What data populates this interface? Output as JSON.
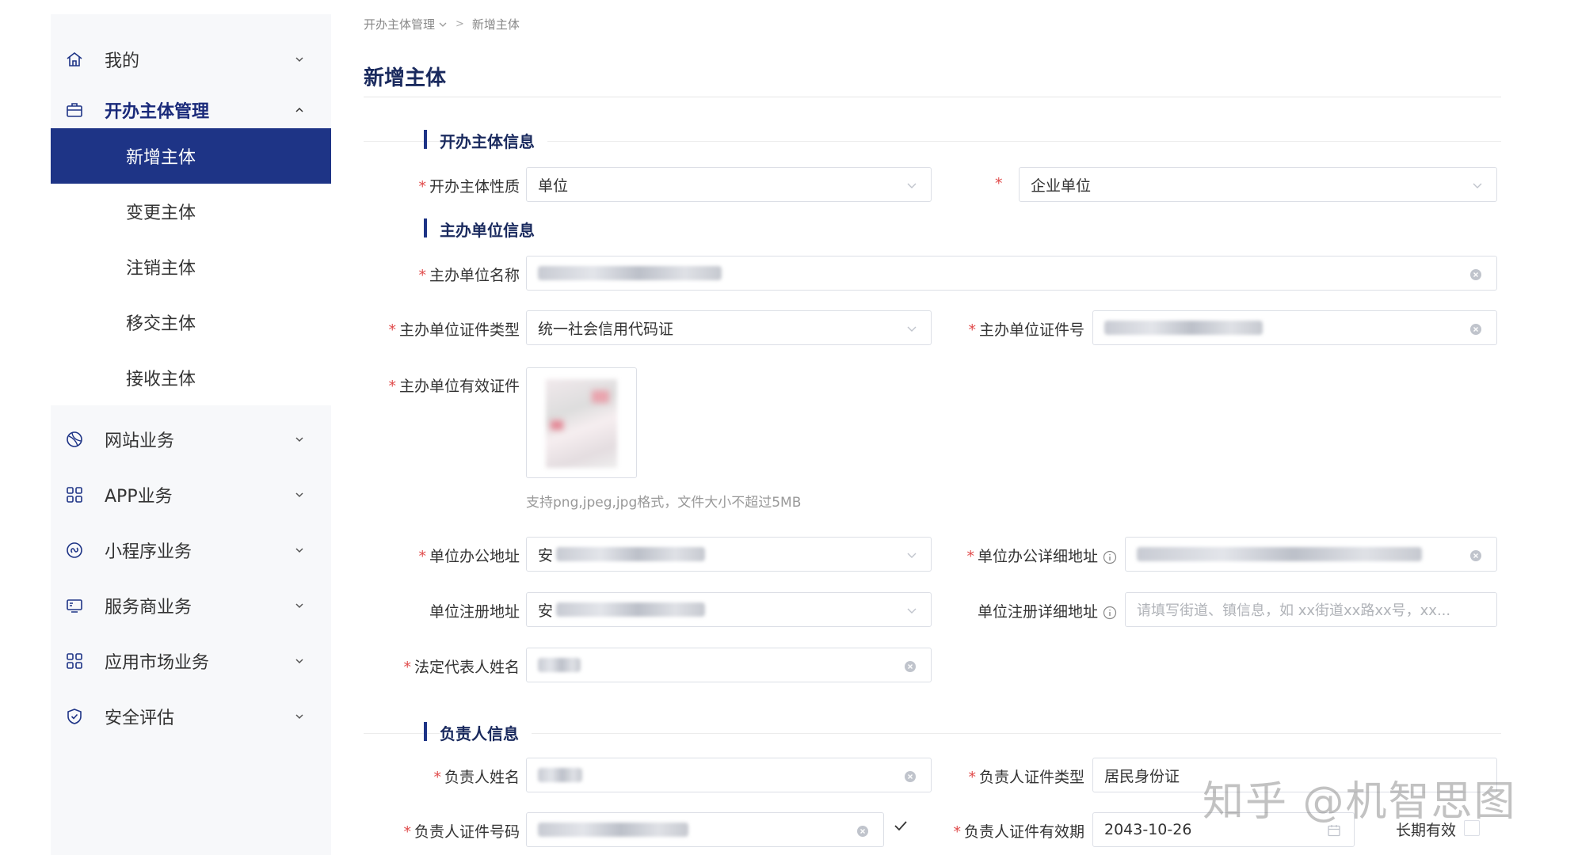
{
  "sidebar": {
    "my": "我的",
    "manage": "开办主体管理",
    "sub": {
      "add": "新增主体",
      "change": "变更主体",
      "cancel": "注销主体",
      "transfer": "移交主体",
      "receive": "接收主体"
    },
    "website": "网站业务",
    "app": "APP业务",
    "miniprogram": "小程序业务",
    "provider": "服务商业务",
    "market": "应用市场业务",
    "security": "安全评估"
  },
  "breadcrumb": {
    "parent": "开办主体管理",
    "sep": ">",
    "current": "新增主体"
  },
  "page_title": "新增主体",
  "sections": {
    "entity_info": "开办主体信息",
    "sponsor_info": "主办单位信息",
    "owner_info": "负责人信息"
  },
  "form": {
    "nature_label": "开办主体性质",
    "nature_value": "单位",
    "unit_type_value": "企业单位",
    "sponsor_name_label": "主办单位名称",
    "cert_type_label": "主办单位证件类型",
    "cert_type_value": "统一社会信用代码证",
    "cert_no_label": "主办单位证件号",
    "valid_cert_label": "主办单位有效证件",
    "upload_hint": "支持png,jpeg,jpg格式，文件大小不超过5MB",
    "office_addr_label": "单位办公地址",
    "office_addr_prefix": "安",
    "office_detail_label": "单位办公详细地址",
    "reg_addr_label": "单位注册地址",
    "reg_addr_prefix": "安",
    "reg_detail_label": "单位注册详细地址",
    "reg_detail_placeholder": "请填写街道、镇信息，如 xx街道xx路xx号，xx...",
    "legal_rep_label": "法定代表人姓名",
    "owner_name_label": "负责人姓名",
    "owner_cert_type_label": "负责人证件类型",
    "owner_cert_type_value": "居民身份证",
    "owner_cert_no_label": "负责人证件号码",
    "owner_validity_label": "负责人证件有效期",
    "owner_validity_value": "2043-10-26",
    "long_term_label": "长期有效"
  },
  "watermark": "知乎 @机智思图",
  "colors": {
    "accent": "#1e3486",
    "required": "#e04a4a",
    "title": "#1a2a5e"
  }
}
